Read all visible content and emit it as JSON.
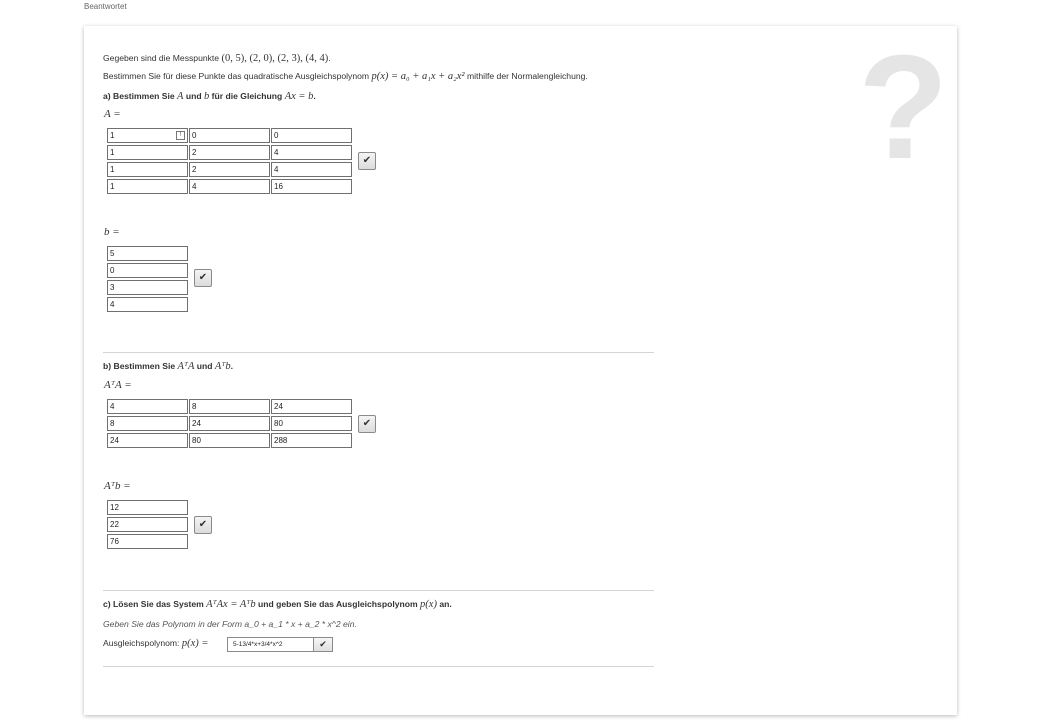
{
  "status": "Beantwortet",
  "help_icon": "question-mark-icon",
  "intro": {
    "given_prefix": "Gegeben sind die Messpunkte ",
    "points": "(0, 5), (2, 0), (2, 3), (4, 4)",
    "given_suffix": ".",
    "task_prefix": "Bestimmen Sie für diese Punkte das quadratische Ausgleichspolynom ",
    "polynomial": "p(x) = a₀ + a₁x + a₂x²",
    "task_suffix": " mithilfe der Normalengleichung."
  },
  "part_a": {
    "heading_prefix": "a) Bestimmen Sie ",
    "A": "A",
    "and": " und ",
    "b": "b",
    "heading_mid": " für die Gleichung ",
    "equation": "Ax = b",
    "period": ".",
    "A_label": "A =",
    "A_rows": [
      [
        "1",
        "0",
        "0"
      ],
      [
        "1",
        "2",
        "4"
      ],
      [
        "1",
        "2",
        "4"
      ],
      [
        "1",
        "4",
        "16"
      ]
    ],
    "b_label": "b =",
    "b_rows": [
      "5",
      "0",
      "3",
      "4"
    ]
  },
  "part_b": {
    "heading_prefix": "b) Bestimmen Sie ",
    "ATA": "AᵀA",
    "and": " und ",
    "ATb": "Aᵀb",
    "period": ".",
    "ATA_label": "AᵀA =",
    "ATA_rows": [
      [
        "4",
        "8",
        "24"
      ],
      [
        "8",
        "24",
        "80"
      ],
      [
        "24",
        "80",
        "288"
      ]
    ],
    "ATb_label": "Aᵀb =",
    "ATb_rows": [
      "12",
      "22",
      "76"
    ]
  },
  "part_c": {
    "heading_prefix": "c) Lösen Sie das System ",
    "system": "AᵀAx = Aᵀb",
    "heading_suffix": " und geben Sie das Ausgleichspolynom ",
    "px": "p(x)",
    "heading_end": " an.",
    "hint": "Geben Sie das Polynom in der Form a_0 + a_1 * x + a_2 * x^2 ein.",
    "answer_label": "Ausgleichspolynom: ",
    "answer_math": "p(x) =",
    "answer_value": "5-13/4*x+3/4*x^2"
  },
  "check_glyph": "✔",
  "warn_glyph": "!"
}
